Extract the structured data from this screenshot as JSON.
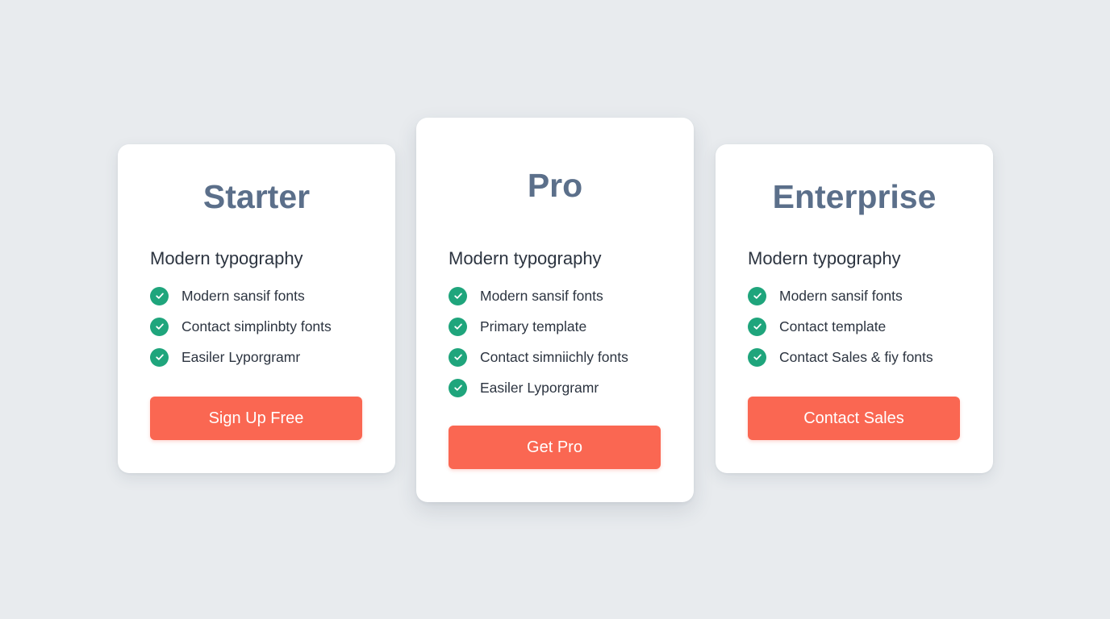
{
  "colors": {
    "background": "#e8ebee",
    "card": "#ffffff",
    "title": "#5b6f8a",
    "text": "#2c3440",
    "check": "#1fa57c",
    "button": "#fa6752"
  },
  "plans": [
    {
      "name": "Starter",
      "subtitle": "Modern typography",
      "features": [
        {
          "icon": "check-circle-icon",
          "label": "Modern sansif fonts"
        },
        {
          "icon": "check-circle-icon",
          "label": "Contact simplinbty fonts"
        },
        {
          "icon": "check-circle-icon",
          "label": "Easiler Lyporgramr"
        }
      ],
      "button_label": "Sign Up Free"
    },
    {
      "name": "Pro",
      "subtitle": "Modern typography",
      "features": [
        {
          "icon": "check-circle-icon",
          "label": "Modern sansif fonts"
        },
        {
          "icon": "check-circle-icon",
          "label": "Primary template"
        },
        {
          "icon": "check-circle-icon",
          "label": "Contact simniichly fonts"
        },
        {
          "icon": "check-circle-icon",
          "label": "Easiler Lyporgramr"
        }
      ],
      "button_label": "Get Pro"
    },
    {
      "name": "Enterprise",
      "subtitle": "Modern typography",
      "features": [
        {
          "icon": "check-circle-icon",
          "label": "Modern sansif fonts"
        },
        {
          "icon": "check-circle-icon",
          "label": "Contact template"
        },
        {
          "icon": "check-circle-icon",
          "label": "Contact Sales & fiy fonts"
        }
      ],
      "button_label": "Contact Sales"
    }
  ]
}
